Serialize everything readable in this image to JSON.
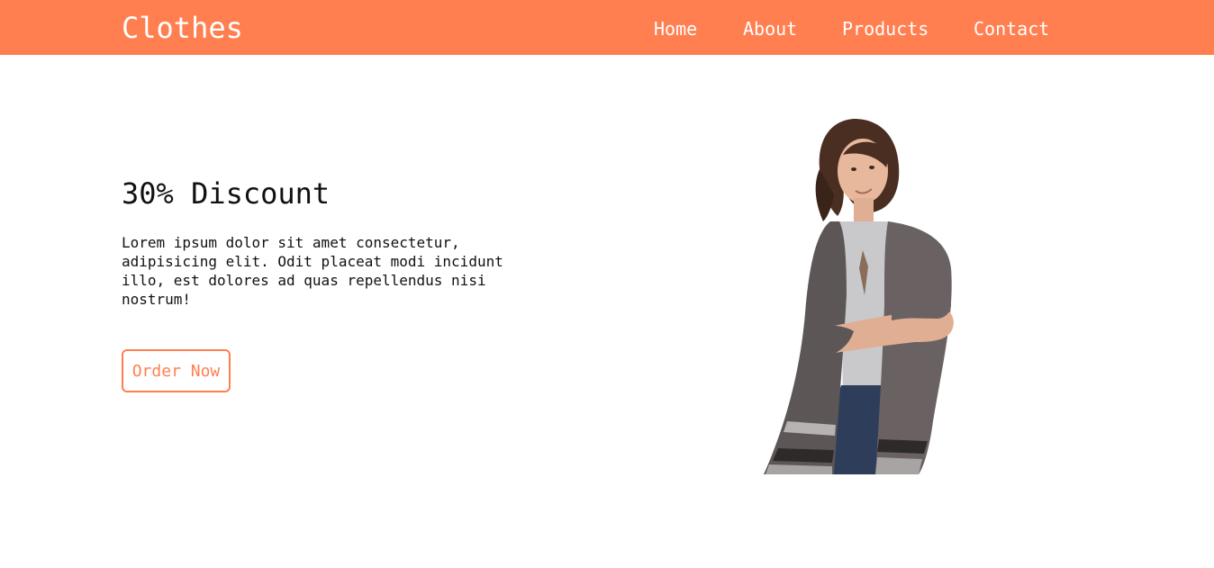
{
  "navbar": {
    "brand": "Clothes",
    "items": [
      {
        "label": "Home"
      },
      {
        "label": "About"
      },
      {
        "label": "Products"
      },
      {
        "label": "Contact"
      }
    ]
  },
  "hero": {
    "title": "30% Discount",
    "description": "Lorem ipsum dolor sit amet consectetur, adipisicing elit. Odit placeat modi incidunt illo, est dolores ad quas repellendus nisi nostrum!",
    "cta_label": "Order Now"
  },
  "colors": {
    "accent": "#ff7f50",
    "text": "#111111",
    "background": "#ffffff"
  }
}
